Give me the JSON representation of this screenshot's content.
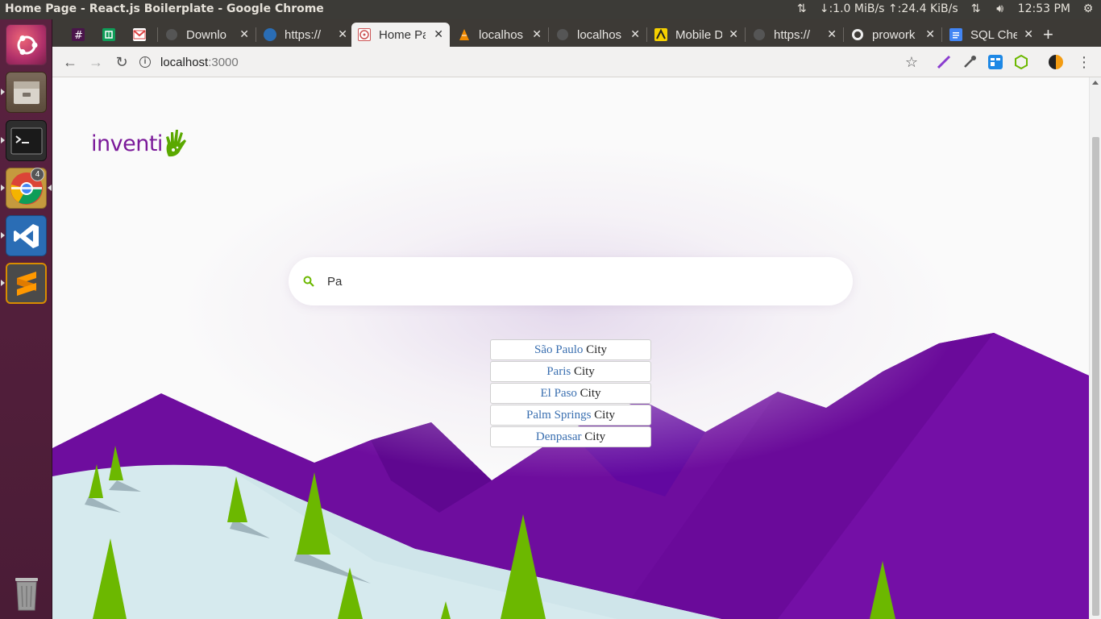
{
  "os": {
    "window_title": "Home Page - React.js Boilerplate - Google Chrome",
    "net_speed": "↓:1.0 MiB/s ↑:24.4 KiB/s",
    "clock": "12:53 PM",
    "chrome_badge": "4"
  },
  "browser": {
    "tabs": [
      {
        "label": "",
        "icon": "slack-icon"
      },
      {
        "label": "",
        "icon": "sheets-icon"
      },
      {
        "label": "",
        "icon": "gmail-icon"
      },
      {
        "label": "Downlo",
        "icon": "github-icon"
      },
      {
        "label": "https://",
        "icon": "web-icon"
      },
      {
        "label": "Home Pa",
        "icon": "react-icon",
        "active": true
      },
      {
        "label": "localhos",
        "icon": "vlc-icon"
      },
      {
        "label": "localhos",
        "icon": "github-icon"
      },
      {
        "label": "Mobile D",
        "icon": "yellow-icon"
      },
      {
        "label": "https://",
        "icon": "github-icon"
      },
      {
        "label": "prowork",
        "icon": "github-icon"
      },
      {
        "label": "SQL Che",
        "icon": "docs-icon"
      }
    ],
    "url_host": "localhost",
    "url_port": ":3000"
  },
  "page": {
    "logo_text": "inventi",
    "search_value": "Pa",
    "suggestions": [
      {
        "city": "São Paulo",
        "suffix": "City"
      },
      {
        "city": "Paris",
        "suffix": "City"
      },
      {
        "city": "El Paso",
        "suffix": "City"
      },
      {
        "city": "Palm Springs",
        "suffix": "City"
      },
      {
        "city": "Denpasar",
        "suffix": "City"
      }
    ]
  },
  "colors": {
    "brand_purple": "#7b1a9a",
    "mountain_purple": "#6a0a9a",
    "tree_green": "#6cb800",
    "snow": "#d8ecef"
  }
}
